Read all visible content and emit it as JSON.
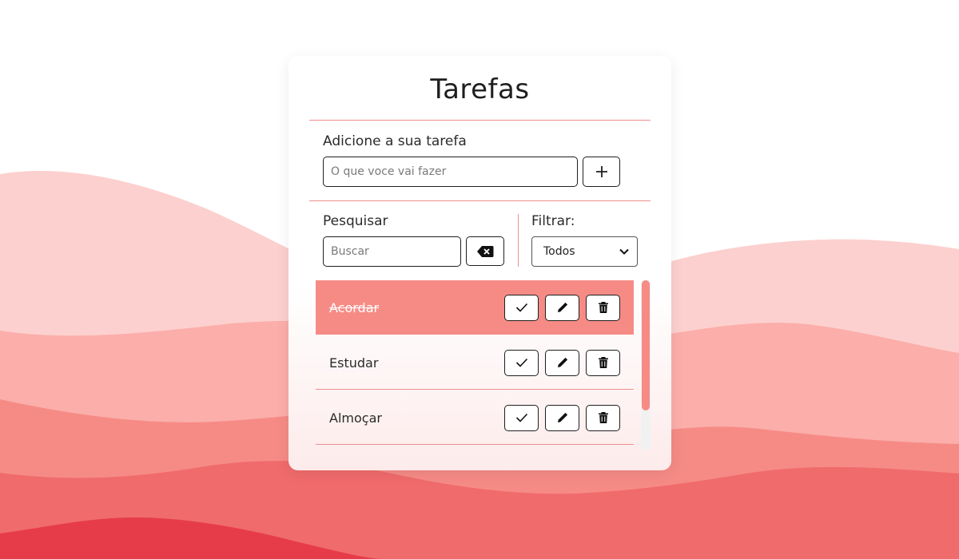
{
  "app": {
    "title": "Tarefas"
  },
  "colors": {
    "accent": "#f68b86",
    "wave1": "#fcd0ce",
    "wave2": "#fbaeaa",
    "wave3": "#f68b86",
    "wave4": "#f06b6c",
    "wave5": "#e63c4a"
  },
  "add": {
    "label": "Adicione a sua tarefa",
    "placeholder": "O que voce vai fazer",
    "value": "",
    "button_icon": "plus-icon"
  },
  "search": {
    "label": "Pesquisar",
    "placeholder": "Buscar",
    "value": "",
    "clear_icon": "backspace-icon"
  },
  "filter": {
    "label": "Filtrar:",
    "selected": "Todos",
    "icon": "chevron-down-icon"
  },
  "todos": [
    {
      "text": "Acordar",
      "done": true
    },
    {
      "text": "Estudar",
      "done": false
    },
    {
      "text": "Almoçar",
      "done": false
    }
  ],
  "actions": {
    "finish_icon": "check-icon",
    "edit_icon": "pencil-icon",
    "remove_icon": "trash-icon"
  }
}
